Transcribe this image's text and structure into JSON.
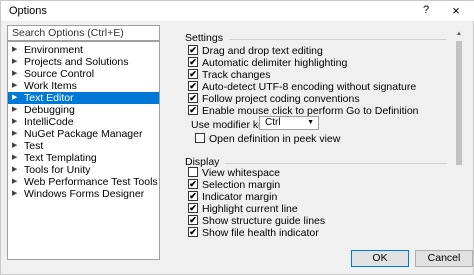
{
  "window": {
    "title": "Options",
    "help_label": "?",
    "close_label": "×"
  },
  "search": {
    "placeholder": "Search Options (Ctrl+E)"
  },
  "tree": {
    "items": [
      {
        "label": "Environment",
        "arrow": "▶"
      },
      {
        "label": "Projects and Solutions",
        "arrow": "▶"
      },
      {
        "label": "Source Control",
        "arrow": "▶"
      },
      {
        "label": "Work Items",
        "arrow": "▶"
      },
      {
        "label": "Text Editor",
        "arrow": "▶",
        "selected": true
      },
      {
        "label": "Debugging",
        "arrow": "▶"
      },
      {
        "label": "IntelliCode",
        "arrow": "▶"
      },
      {
        "label": "NuGet Package Manager",
        "arrow": "▶"
      },
      {
        "label": "Test",
        "arrow": "▶"
      },
      {
        "label": "Text Templating",
        "arrow": "▶"
      },
      {
        "label": "Tools for Unity",
        "arrow": "▶"
      },
      {
        "label": "Web Performance Test Tools",
        "arrow": "▶"
      },
      {
        "label": "Windows Forms Designer",
        "arrow": "▶"
      }
    ]
  },
  "settings": {
    "heading": "Settings",
    "options": [
      {
        "label": "Drag and drop text editing",
        "checked": true
      },
      {
        "label": "Automatic delimiter highlighting",
        "checked": true
      },
      {
        "label": "Track changes",
        "checked": true
      },
      {
        "label": "Auto-detect UTF-8 encoding without signature",
        "checked": true
      },
      {
        "label": "Follow project coding conventions",
        "checked": true
      },
      {
        "label": "Enable mouse click to perform Go to Definition",
        "checked": true
      }
    ],
    "modifier_label": "Use modifier key:",
    "modifier_value": "Ctrl",
    "open_def_label": "Open definition in peek view",
    "open_def_checked": false
  },
  "display": {
    "heading": "Display",
    "options": [
      {
        "label": "View whitespace",
        "checked": false
      },
      {
        "label": "Selection margin",
        "checked": true
      },
      {
        "label": "Indicator margin",
        "checked": true
      },
      {
        "label": "Highlight current line",
        "checked": true
      },
      {
        "label": "Show structure guide lines",
        "checked": true
      },
      {
        "label": "Show file health indicator",
        "checked": true
      }
    ]
  },
  "buttons": {
    "ok": "OK",
    "cancel": "Cancel"
  },
  "icons": {
    "check": "✔",
    "dropdown_arrow": "▼",
    "scroll_up": "▲",
    "scroll_down": "▼"
  }
}
